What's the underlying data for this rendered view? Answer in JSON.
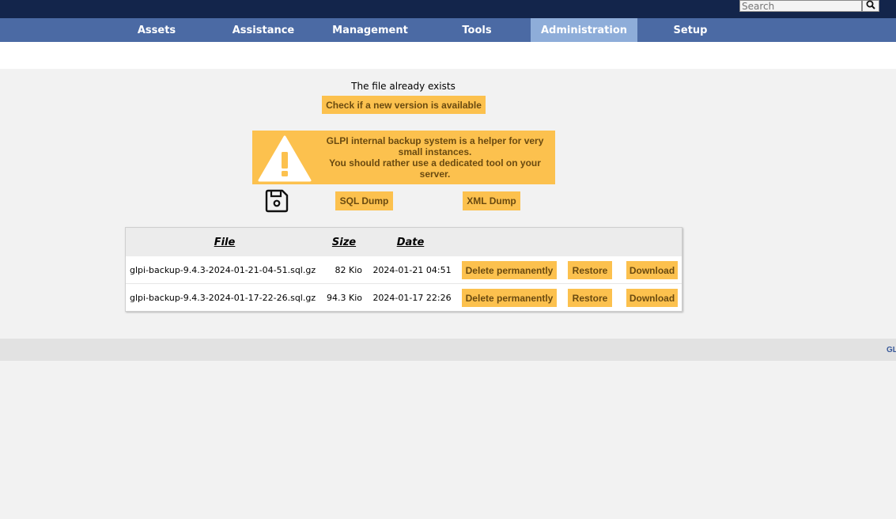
{
  "search": {
    "placeholder": "Search"
  },
  "menu": [
    {
      "label": "Assets"
    },
    {
      "label": "Assistance"
    },
    {
      "label": "Management"
    },
    {
      "label": "Tools"
    },
    {
      "label": "Administration"
    },
    {
      "label": "Setup"
    }
  ],
  "status": {
    "message": "The file already exists",
    "check_button": "Check if a new version is available"
  },
  "warning": {
    "line1": "GLPI internal backup system is a helper for very small instances.",
    "line2": "You should rather use a dedicated tool on your server."
  },
  "dump": {
    "sql_label": "SQL Dump",
    "xml_label": "XML Dump"
  },
  "table": {
    "headers": {
      "file": "File",
      "size": "Size",
      "date": "Date"
    },
    "rows": [
      {
        "file": "glpi-backup-9.4.3-2024-01-21-04-51.sql.gz",
        "size": "82 Kio",
        "date": "2024-01-21 04:51",
        "delete": "Delete permanently",
        "restore": "Restore",
        "download": "Download"
      },
      {
        "file": "glpi-backup-9.4.3-2024-01-17-22-26.sql.gz",
        "size": "94.3 Kio",
        "date": "2024-01-17 22:26",
        "delete": "Delete permanently",
        "restore": "Restore",
        "download": "Download"
      }
    ]
  },
  "footer": {
    "link": "GLPI"
  },
  "colors": {
    "topbar": "#13254b",
    "menubar": "#4b6aa4",
    "active_menu": "#8eadd9",
    "button": "#fcc14e"
  },
  "icons": {
    "search": "search-icon",
    "warning": "warning-icon",
    "save": "save-icon"
  }
}
